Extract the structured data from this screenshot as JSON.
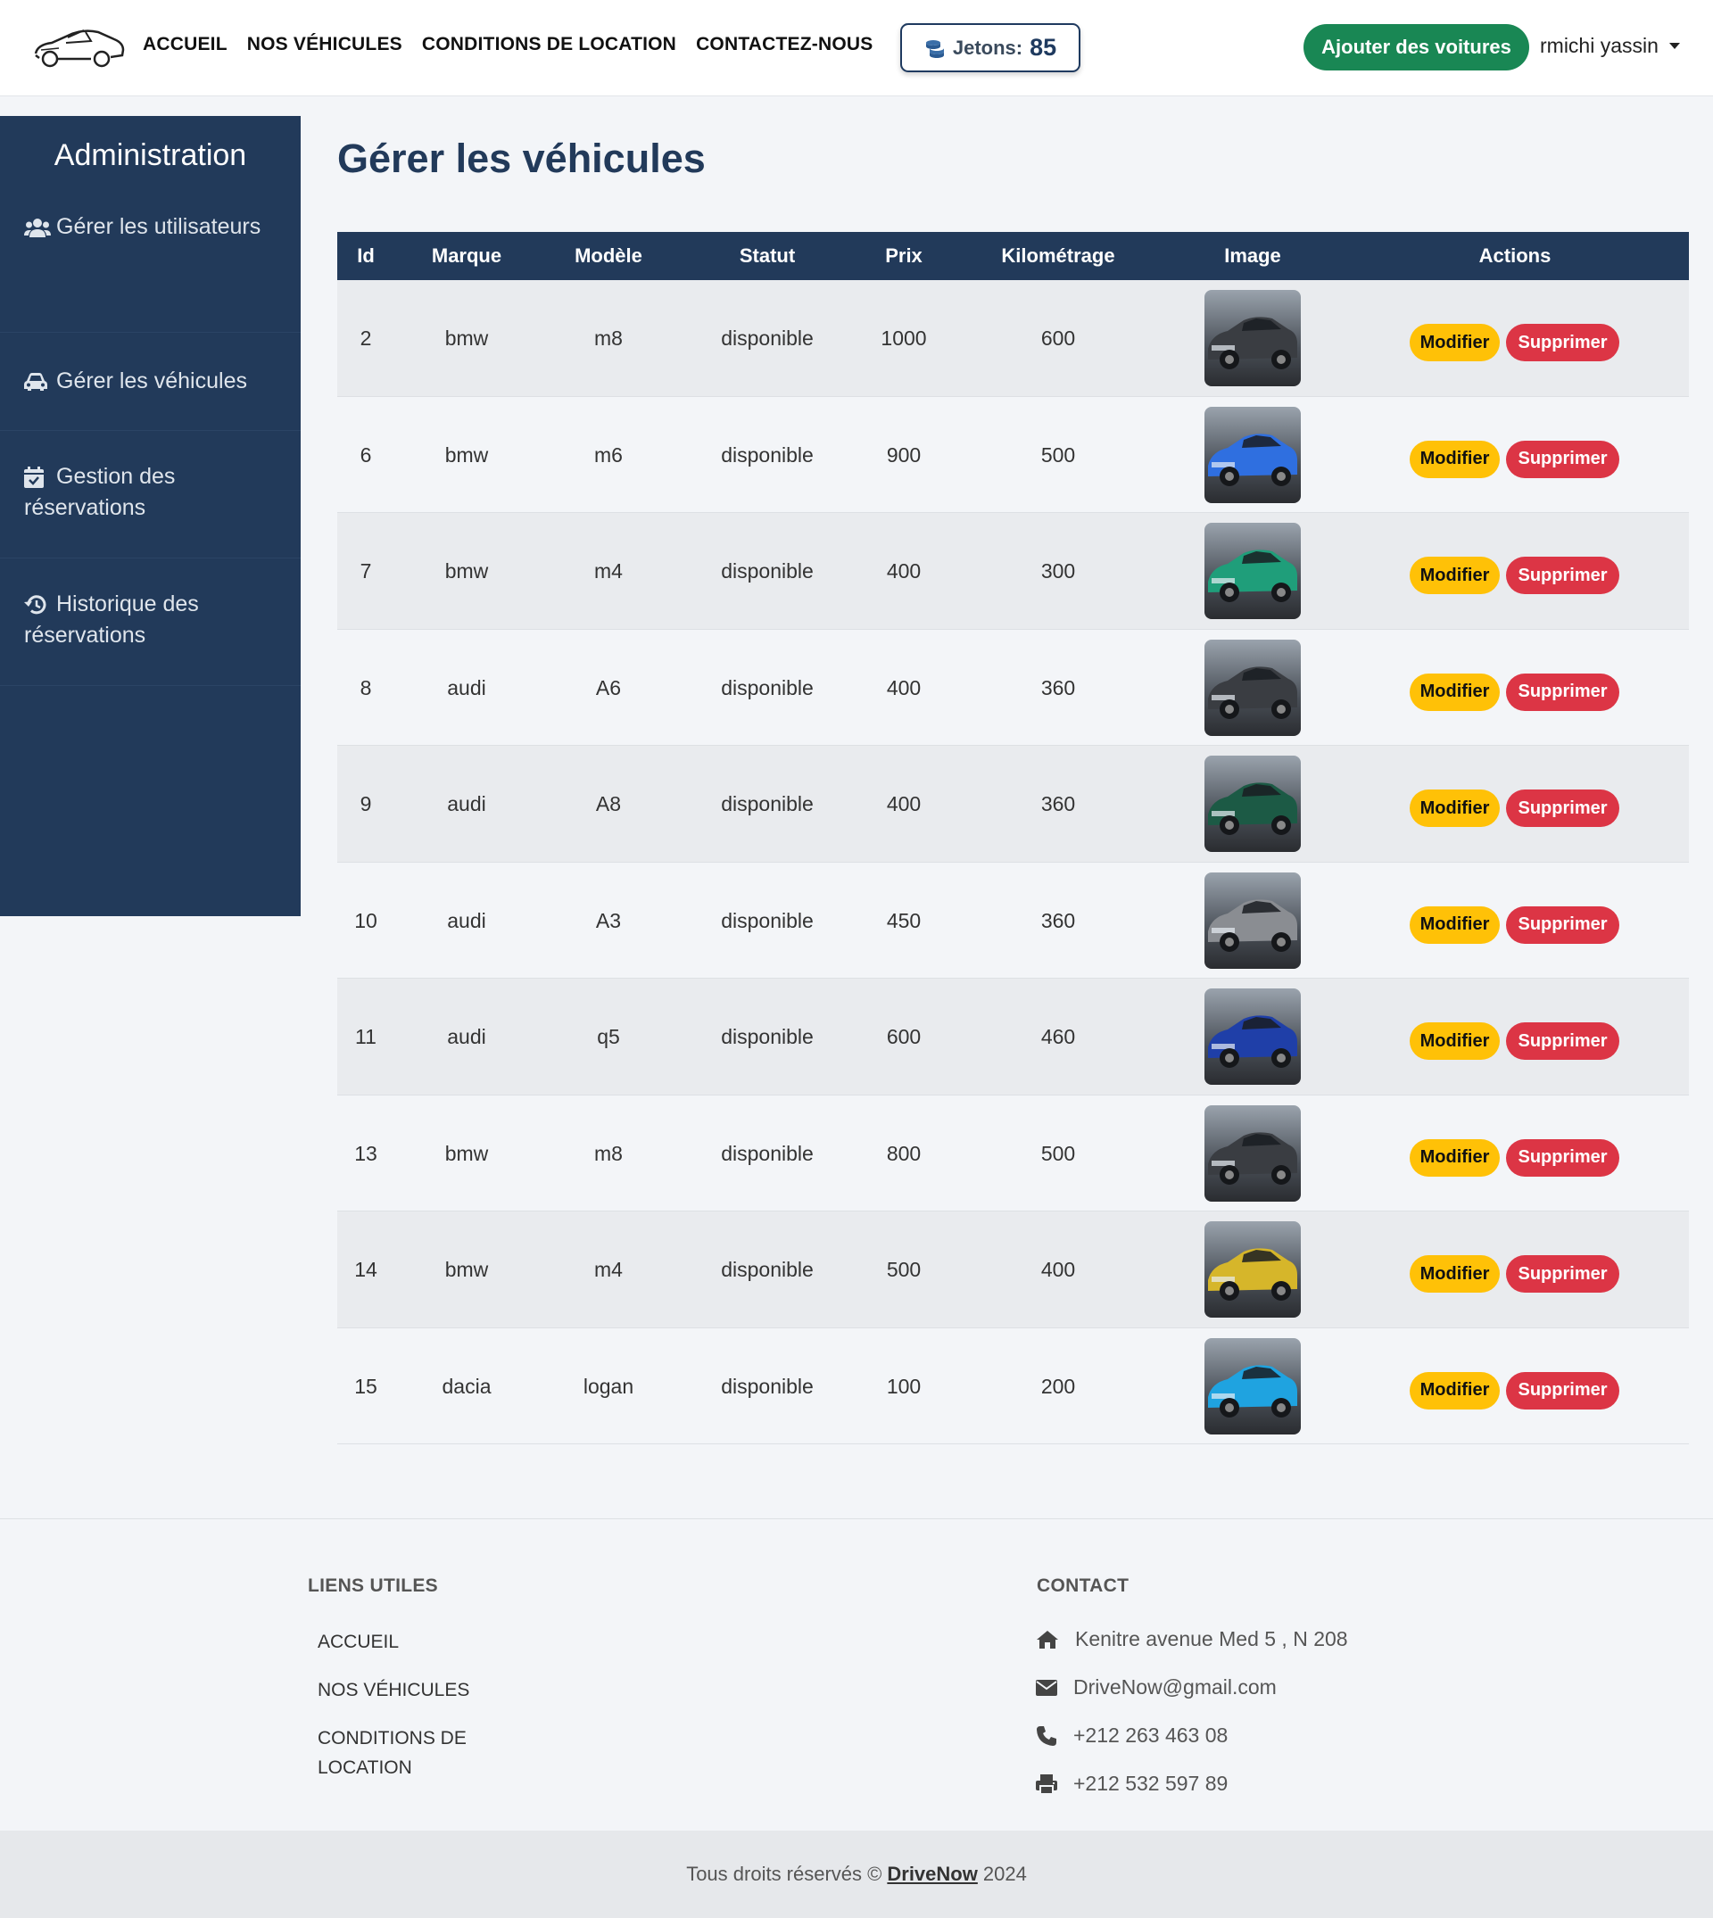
{
  "colors": {
    "navy": "#223a5a",
    "green": "#198754",
    "yellow": "#ffc107",
    "red": "#dc3545"
  },
  "nav": {
    "logo_icon": "car-logo-icon",
    "links": [
      "ACCUEIL",
      "NOS VÉHICULES",
      "CONDITIONS DE LOCATION",
      "CONTACTEZ-NOUS"
    ],
    "tokens_label": "Jetons:",
    "tokens_value": "85",
    "tokens_icon": "coins-icon",
    "add_cars": "Ajouter des voitures",
    "user_name": "rmichi yassin"
  },
  "sidebar": {
    "title": "Administration",
    "items": [
      {
        "label": "Gérer les utilisateurs",
        "icon": "users-icon"
      },
      {
        "label": "Gérer les véhicules",
        "icon": "car-icon"
      },
      {
        "label": "Gestion des réservations",
        "icon": "calendar-check-icon"
      },
      {
        "label": "Historique des réservations",
        "icon": "history-icon"
      }
    ]
  },
  "main": {
    "title": "Gérer les véhicules",
    "columns": [
      "Id",
      "Marque",
      "Modèle",
      "Statut",
      "Prix",
      "Kilométrage",
      "Image",
      "Actions"
    ],
    "edit_label": "Modifier",
    "delete_label": "Supprimer",
    "rows": [
      {
        "id": "2",
        "brand": "bmw",
        "model": "m8",
        "status": "disponible",
        "price": "1000",
        "mileage": "600",
        "car_color": "#3a3d42"
      },
      {
        "id": "6",
        "brand": "bmw",
        "model": "m6",
        "status": "disponible",
        "price": "900",
        "mileage": "500",
        "car_color": "#2f6fe0"
      },
      {
        "id": "7",
        "brand": "bmw",
        "model": "m4",
        "status": "disponible",
        "price": "400",
        "mileage": "300",
        "car_color": "#1f9e7a"
      },
      {
        "id": "8",
        "brand": "audi",
        "model": "A6",
        "status": "disponible",
        "price": "400",
        "mileage": "360",
        "car_color": "#3a3d42"
      },
      {
        "id": "9",
        "brand": "audi",
        "model": "A8",
        "status": "disponible",
        "price": "400",
        "mileage": "360",
        "car_color": "#1c5a45"
      },
      {
        "id": "10",
        "brand": "audi",
        "model": "A3",
        "status": "disponible",
        "price": "450",
        "mileage": "360",
        "car_color": "#8a8d92"
      },
      {
        "id": "11",
        "brand": "audi",
        "model": "q5",
        "status": "disponible",
        "price": "600",
        "mileage": "460",
        "car_color": "#1f3fa8"
      },
      {
        "id": "13",
        "brand": "bmw",
        "model": "m8",
        "status": "disponible",
        "price": "800",
        "mileage": "500",
        "car_color": "#3a3d42"
      },
      {
        "id": "14",
        "brand": "bmw",
        "model": "m4",
        "status": "disponible",
        "price": "500",
        "mileage": "400",
        "car_color": "#d6b62a"
      },
      {
        "id": "15",
        "brand": "dacia",
        "model": "logan",
        "status": "disponible",
        "price": "100",
        "mileage": "200",
        "car_color": "#1fa3e0"
      }
    ]
  },
  "footer": {
    "links_heading": "LIENS UTILES",
    "links": [
      "ACCUEIL",
      "NOS VÉHICULES",
      "CONDITIONS DE LOCATION"
    ],
    "contact_heading": "CONTACT",
    "address": "Kenitre avenue Med 5 , N 208",
    "email": "DriveNow@gmail.com",
    "phone": "+212 263 463 08",
    "fax": "+212 532 597 89",
    "copyright_prefix": "Tous droits réservés ©",
    "brand": "DriveNow",
    "year": "2024"
  }
}
